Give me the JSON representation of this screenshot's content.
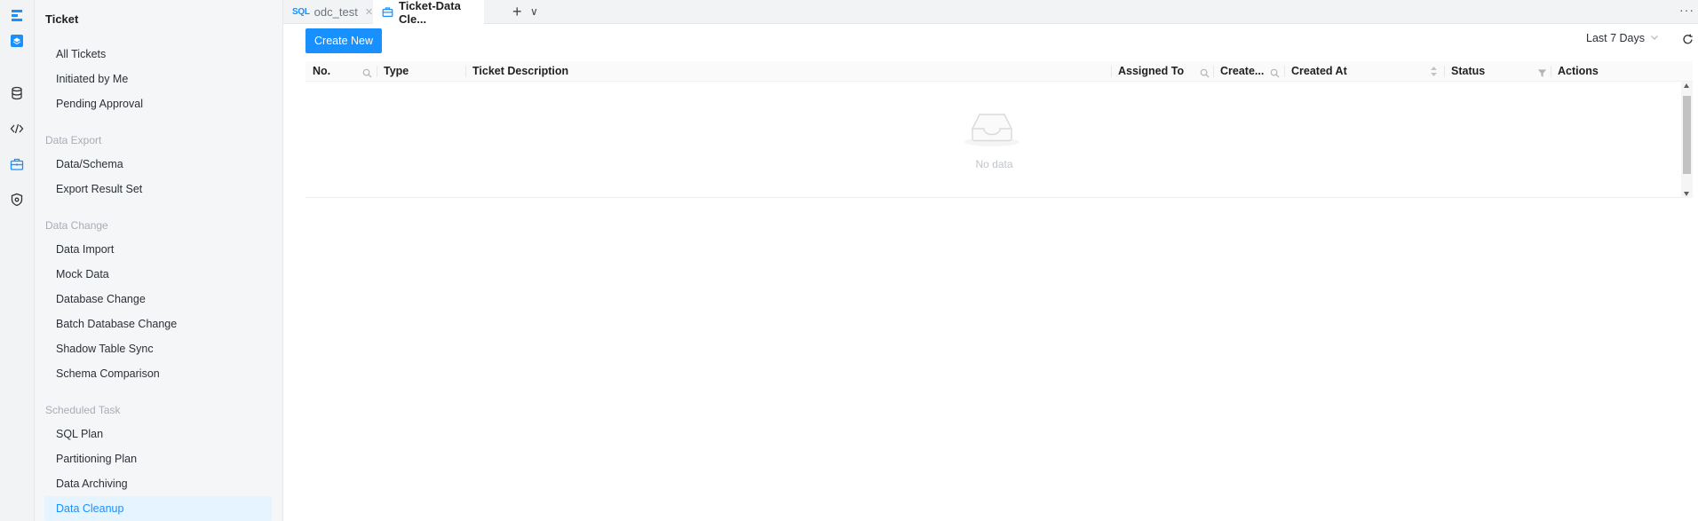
{
  "rail": {
    "icons": [
      "logo-icon",
      "ticket-nav-icon",
      "database-icon",
      "code-icon",
      "briefcase-icon",
      "security-icon"
    ],
    "accent": "#1890ff"
  },
  "menu": {
    "title": "Ticket",
    "top_items": [
      "All Tickets",
      "Initiated by Me",
      "Pending Approval"
    ],
    "sections": [
      {
        "title": "Data Export",
        "items": [
          "Data/Schema",
          "Export Result Set"
        ]
      },
      {
        "title": "Data Change",
        "items": [
          "Data Import",
          "Mock Data",
          "Database Change",
          "Batch Database Change",
          "Shadow Table Sync",
          "Schema Comparison"
        ]
      },
      {
        "title": "Scheduled Task",
        "items": [
          "SQL Plan",
          "Partitioning Plan",
          "Data Archiving",
          "Data Cleanup"
        ]
      }
    ],
    "active_item": "Data Cleanup"
  },
  "tabs": {
    "items": [
      {
        "badge": "SQL",
        "label": "odc_test",
        "active": false
      },
      {
        "label": "Ticket-Data Cle...",
        "active": true
      }
    ],
    "add_label": "+",
    "dropdown_label": "∨",
    "more_label": "···"
  },
  "toolbar": {
    "create_label": "Create New",
    "date_range": "Last 7 Days"
  },
  "table": {
    "columns": [
      "No.",
      "Type",
      "Ticket Description",
      "Assigned To",
      "Create...",
      "Created At",
      "Status",
      "Actions"
    ],
    "rows": [],
    "empty_text": "No data"
  },
  "colors": {
    "primary": "#1890ff",
    "active_bg": "#e6f4ff",
    "section_text": "#a8adb5"
  }
}
